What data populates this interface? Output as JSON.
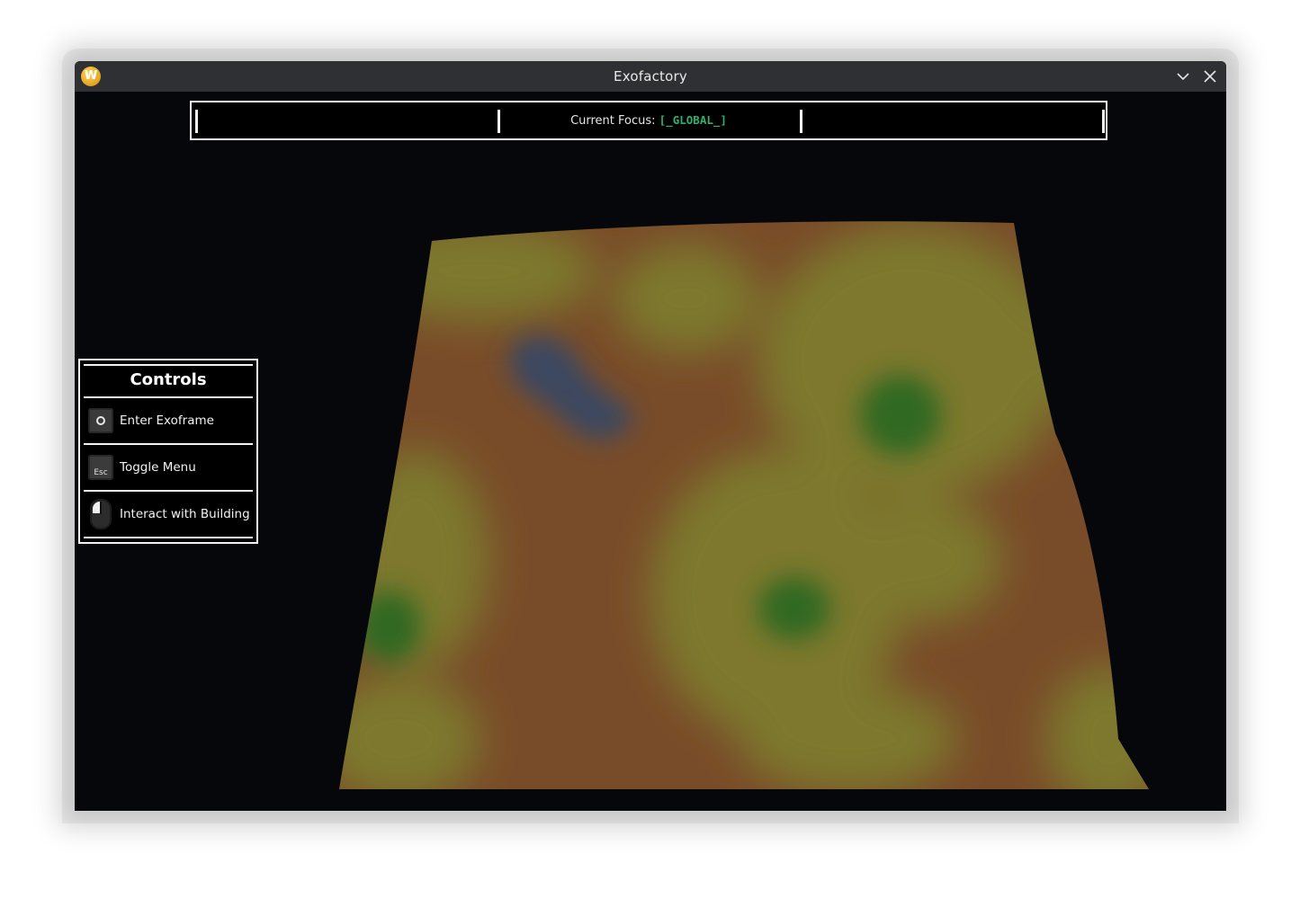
{
  "window": {
    "title": "Exofactory",
    "app_icon_letter": "W",
    "app_icon": "app-logo-icon",
    "minimize_icon": "chevron-down-icon",
    "close_icon": "close-icon"
  },
  "focus_bar": {
    "label": "Current Focus:",
    "value": "[_GLOBAL_]",
    "value_color": "#2fb06e"
  },
  "controls": {
    "title": "Controls",
    "items": [
      {
        "icon": "o-key-icon",
        "label": "Enter Exoframe"
      },
      {
        "icon": "esc-key-icon",
        "key": "Esc",
        "label": "Toggle Menu"
      },
      {
        "icon": "mouse-left-click-icon",
        "label": "Interact with Building"
      }
    ]
  },
  "colors": {
    "background": "#06070b",
    "terrain_dirt": "#7a4d2a",
    "terrain_grass": "#7e7a2e",
    "terrain_moss": "#2f6a22",
    "terrain_water": "#3b4a63"
  }
}
